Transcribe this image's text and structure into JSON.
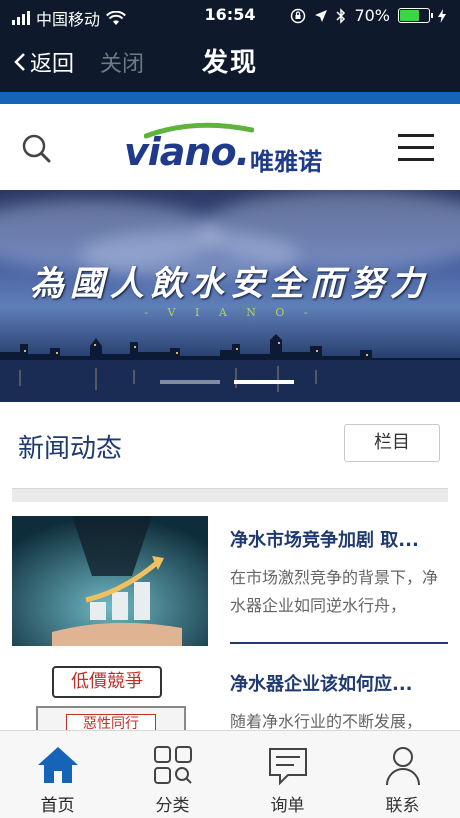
{
  "status_bar": {
    "carrier": "中国移动",
    "time": "16:54",
    "battery_percent": "70%",
    "battery_level": 0.7,
    "battery_color": "#3bd44a"
  },
  "nav": {
    "back_label": "返回",
    "close_label": "关闭",
    "title": "发现"
  },
  "header": {
    "brand": "viano.",
    "brand_cn": "唯雅诺",
    "brand_color": "#1f3a8a",
    "accent_color": "#5db33c"
  },
  "banner": {
    "slogan": "為國人飲水安全而努力",
    "sub": "- V I A N O -",
    "slide_count": 2,
    "active_slide": 2
  },
  "news": {
    "section_title": "新闻动态",
    "column_button": "栏目",
    "articles": [
      {
        "headline": "净水市场竞争加剧 取...",
        "summary": "在市场激烈竞争的背景下，净水器企业如同逆水行舟，",
        "thumb_icon": "growth-chart-hand-image"
      },
      {
        "headline": "净水器企业该如何应...",
        "summary": "随着净水行业的不断发展，",
        "thumb_icon": "low-price-competition-image",
        "thumb_text_1": "低價競爭",
        "thumb_text_2": "惡性同行"
      }
    ]
  },
  "tabbar": {
    "tabs": [
      {
        "label": "首页",
        "icon": "home-icon",
        "active": true
      },
      {
        "label": "分类",
        "icon": "category-grid-icon",
        "active": false
      },
      {
        "label": "询单",
        "icon": "chat-bubble-icon",
        "active": false
      },
      {
        "label": "联系",
        "icon": "person-icon",
        "active": false
      }
    ],
    "active_color": "#1664b8"
  }
}
